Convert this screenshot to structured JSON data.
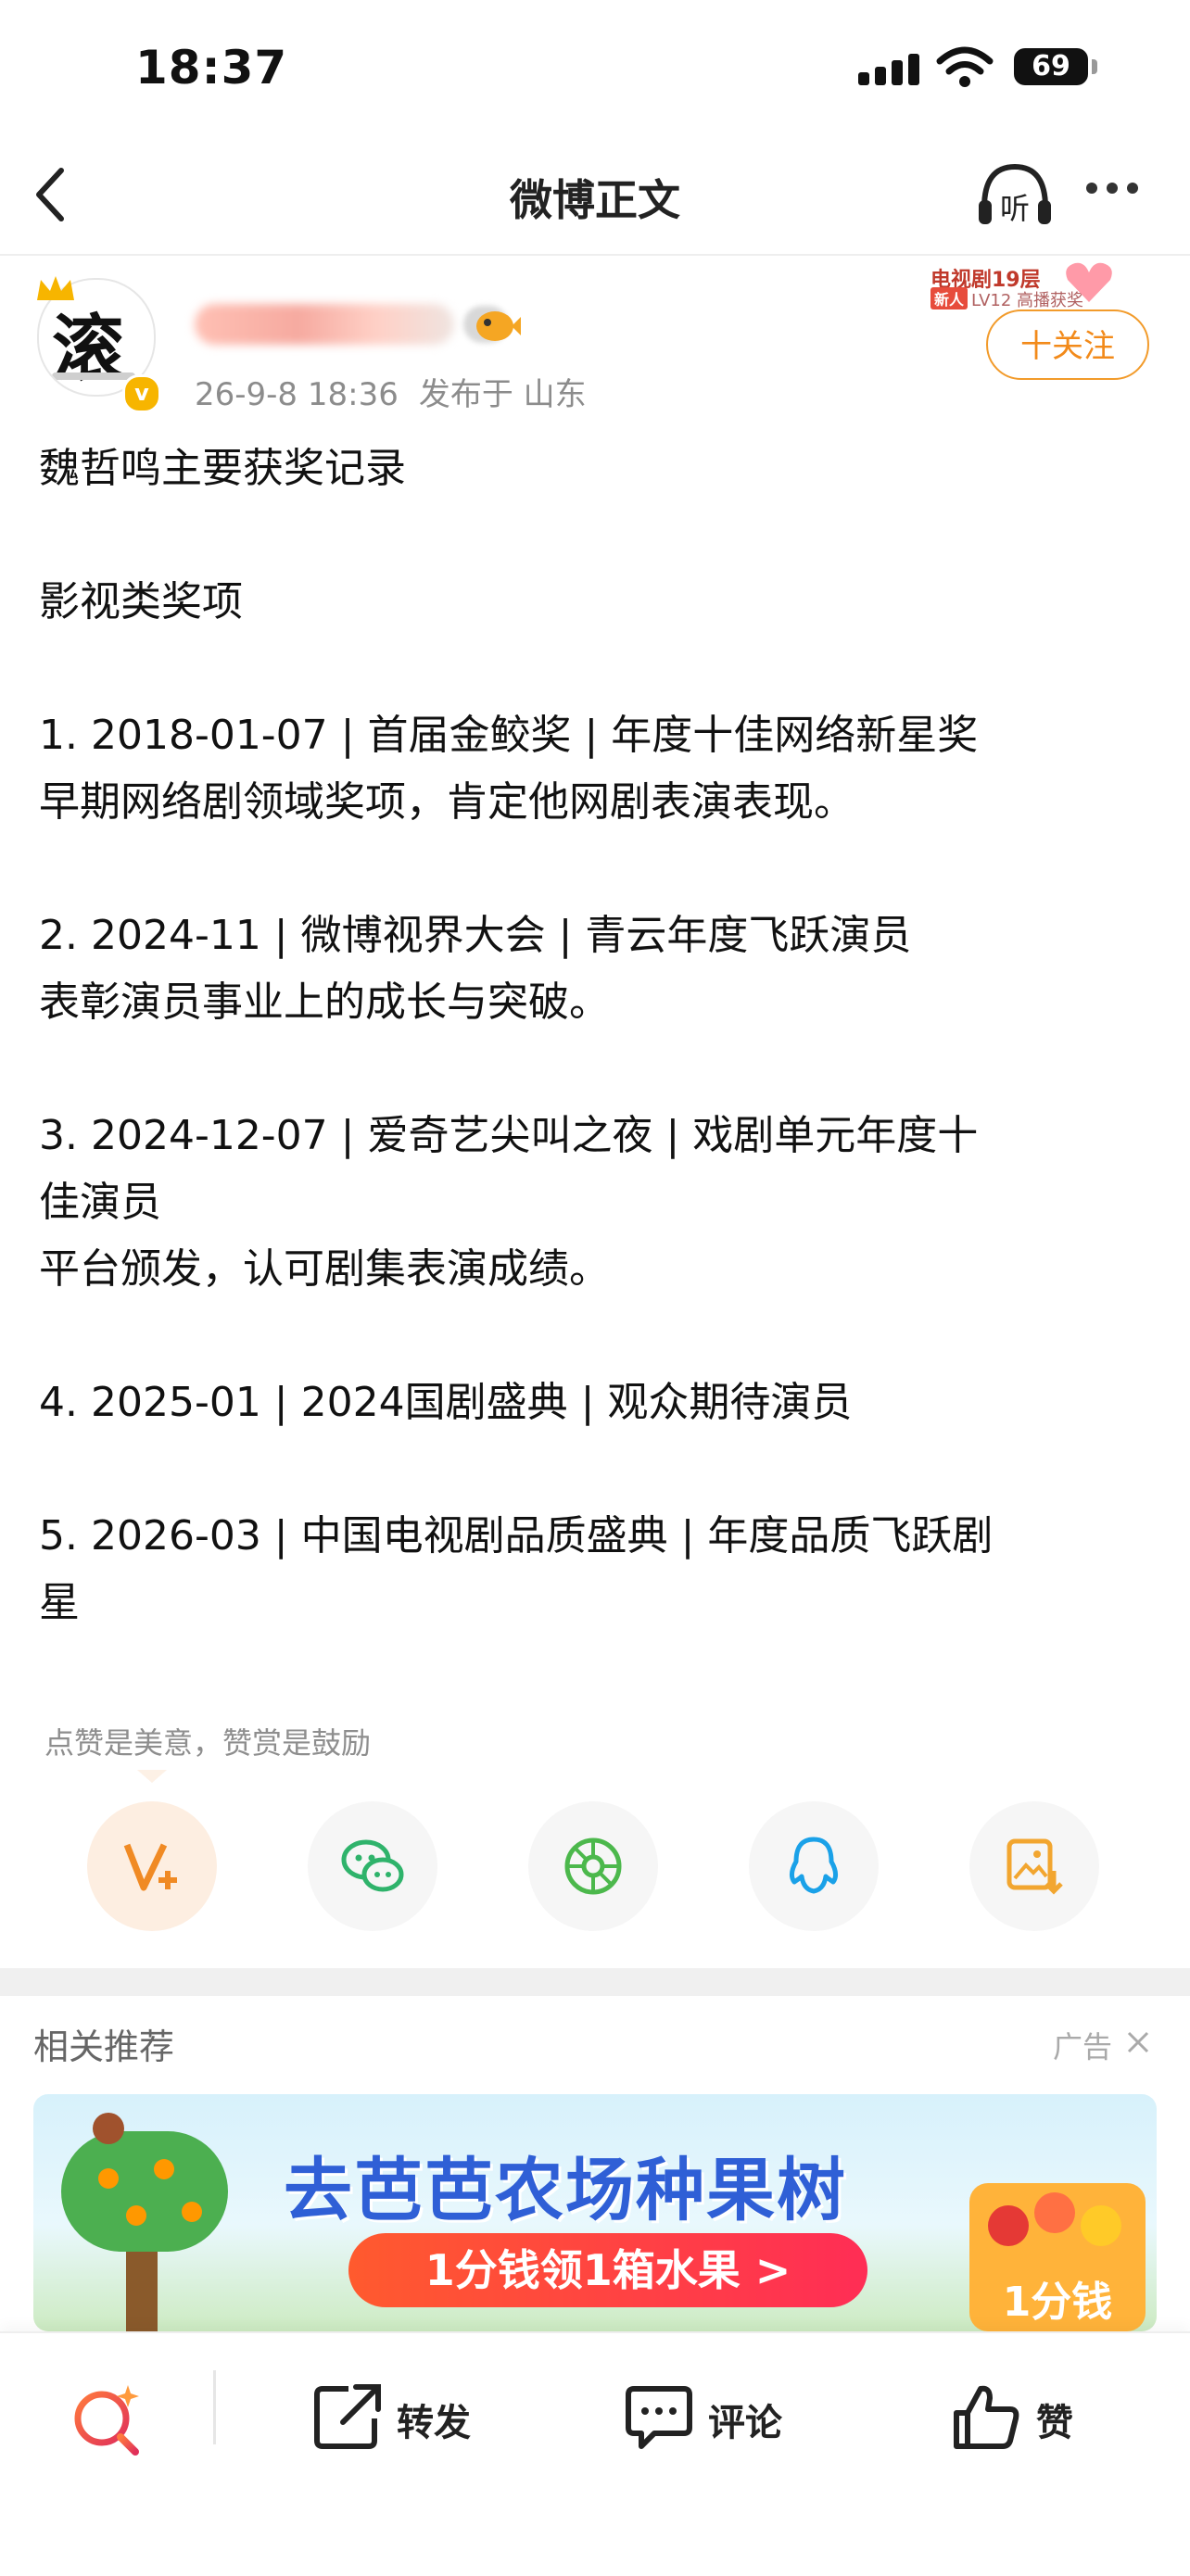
{
  "status_bar": {
    "time": "18:37",
    "battery": "69"
  },
  "nav": {
    "title": "微博正文",
    "listen_label": "听"
  },
  "author": {
    "avatar_glyph": "滚",
    "verified_mark": "v",
    "timestamp": "26-9-8 18:36",
    "location": "发布于 山东",
    "promo_line1": "电视剧19层",
    "promo_badge": "新人",
    "promo_line2": "LV12 高播获奖",
    "follow_label": "十关注"
  },
  "post": {
    "lines": [
      "魏哲鸣主要获奖记录",
      "",
      "影视类奖项",
      "",
      "1. 2018-01-07 | 首届金鲛奖 | 年度十佳网络新星奖",
      "早期网络剧领域奖项，肯定他网剧表演表现。",
      "",
      "2. 2024-11 | 微博视界大会 | 青云年度飞跃演员",
      "表彰演员事业上的成长与突破。",
      "",
      "3. 2024-12-07 | 爱奇艺尖叫之夜 | 戏剧单元年度十",
      "佳演员",
      "平台颁发，认可剧集表演成绩。",
      "",
      "4. 2025-01 | 2024国剧盛典 | 观众期待演员",
      "",
      "5. 2026-03 | 中国电视剧品质盛典 | 年度品质飞跃剧",
      "星"
    ]
  },
  "tip": "点赞是美意，赞赏是鼓励",
  "share_row": [
    {
      "icon": "v-plus-icon",
      "color": "#f08a24"
    },
    {
      "icon": "wechat-icon",
      "color": "#2fb36b"
    },
    {
      "icon": "moments-icon",
      "color": "#4cb84c"
    },
    {
      "icon": "qq-icon",
      "color": "#1aa1e8"
    },
    {
      "icon": "save-image-icon",
      "color": "#f2a630"
    }
  ],
  "related": {
    "title": "相关推荐",
    "ad_label": "广告",
    "banner_title": "去芭芭农场种果树",
    "banner_cta": "1分钱领1箱水果 >",
    "banner_price": "1分钱"
  },
  "toolbar": {
    "repost_label": "转发",
    "comment_label": "评论",
    "like_label": "赞"
  }
}
